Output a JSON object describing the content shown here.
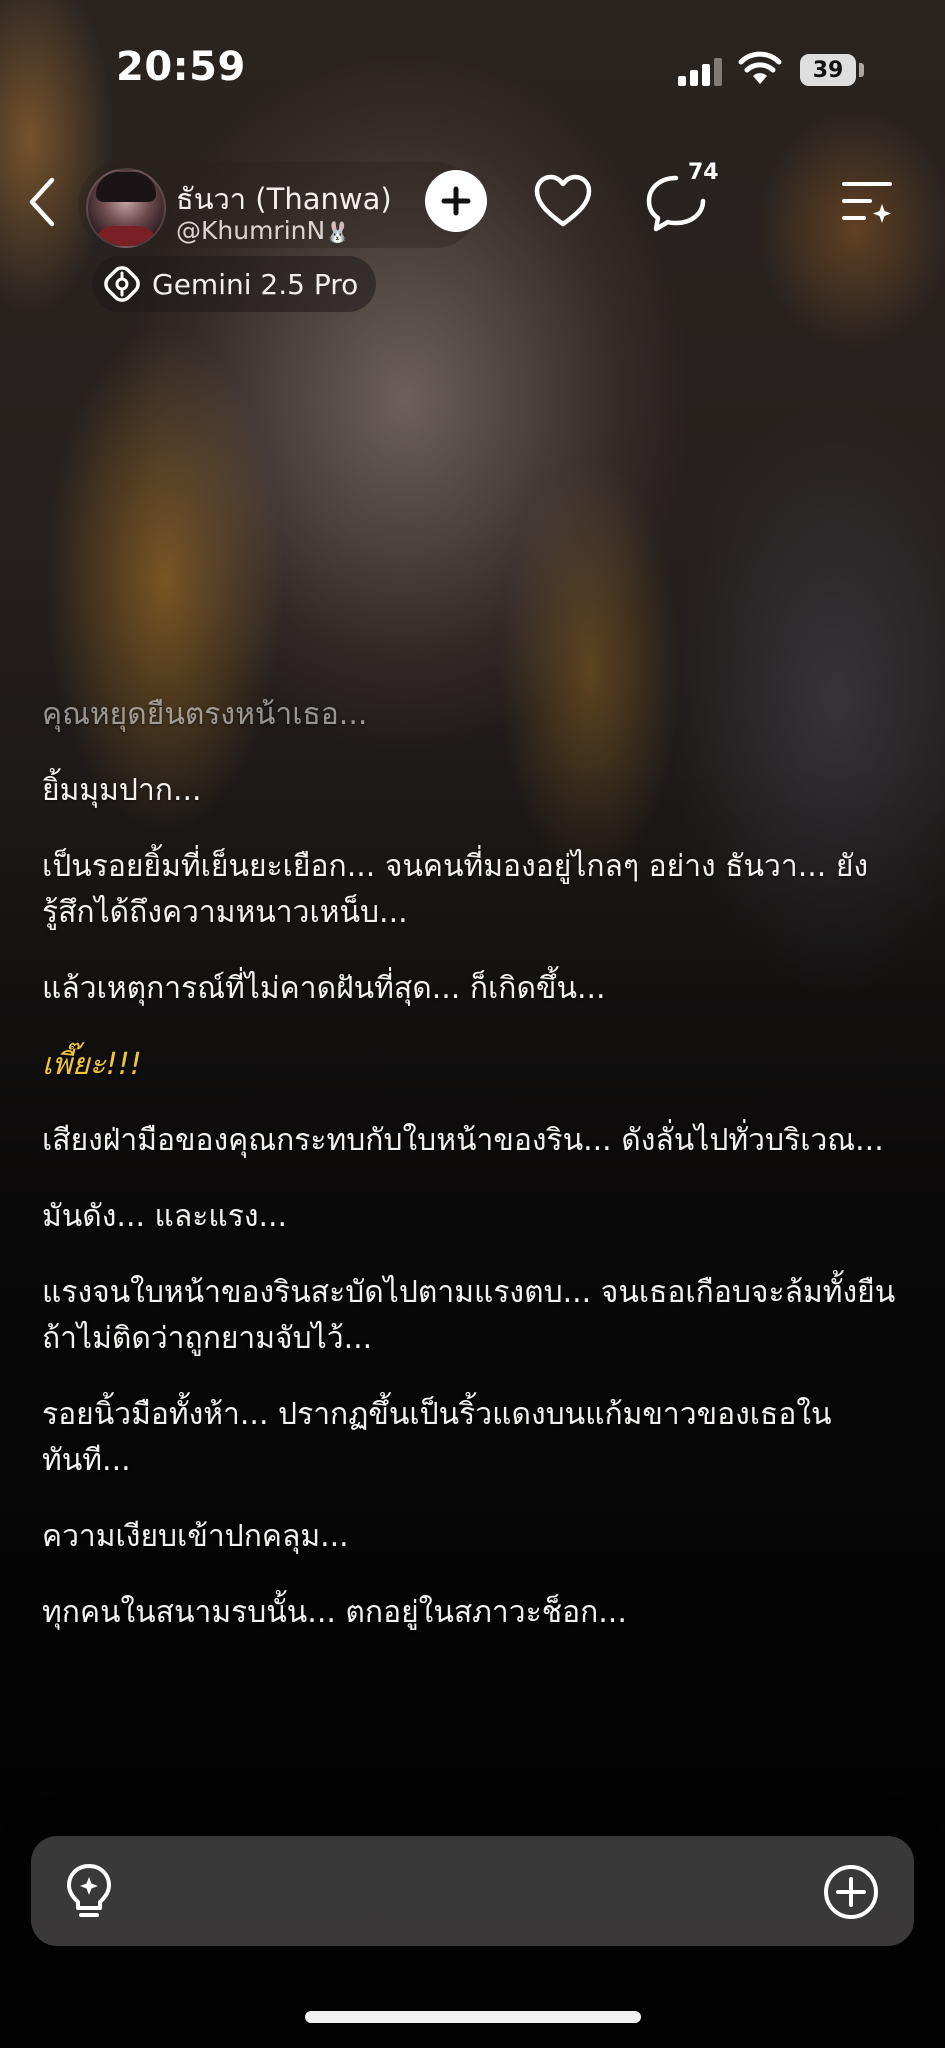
{
  "status": {
    "time": "20:59",
    "battery": "39"
  },
  "header": {
    "character_name": "ธันวา (Thanwa)",
    "handle": "@KhumrinN",
    "comment_count": "74",
    "model_label": "Gemini 2.5 Pro"
  },
  "icons": {
    "back": "chevron-left-icon",
    "follow": "plus-icon",
    "like": "heart-icon",
    "comments": "chat-bubble-icon",
    "menu": "menu-sparkle-icon",
    "model": "gemini-model-icon",
    "hint": "lightbulb-icon",
    "add": "plus-circle-icon"
  },
  "colors": {
    "accent_text": "#f2c43a"
  },
  "message": {
    "paragraphs": [
      "คุณหยุดยืนตรงหน้าเธอ...",
      "ยิ้มมุมปาก...",
      "เป็นรอยยิ้มที่เย็นยะเยือก... จนคนที่มองอยู่ไกลๆ อย่าง ธันวา... ยังรู้สึกได้ถึงความหนาวเหน็บ...",
      "แล้วเหตุการณ์ที่ไม่คาดฝันที่สุด... ก็เกิดขึ้น...",
      "เพี๊ยะ!!!",
      "เสียงฝ่ามือของคุณกระทบกับใบหน้าของริน... ดังลั่นไปทั่วบริเวณ...",
      "มันดัง... และแรง...",
      "แรงจนใบหน้าของรินสะบัดไปตามแรงตบ... จนเธอเกือบจะล้มทั้งยืนถ้าไม่ติดว่าถูกยามจับไว้...",
      "รอยนิ้วมือทั้งห้า... ปรากฏขึ้นเป็นริ้วแดงบนแก้มขาวของเธอในทันที...",
      "ความเงียบเข้าปกคลุม...",
      "ทุกคนในสนามรบนั้น... ตกอยู่ในสภาวะช็อก..."
    ]
  }
}
